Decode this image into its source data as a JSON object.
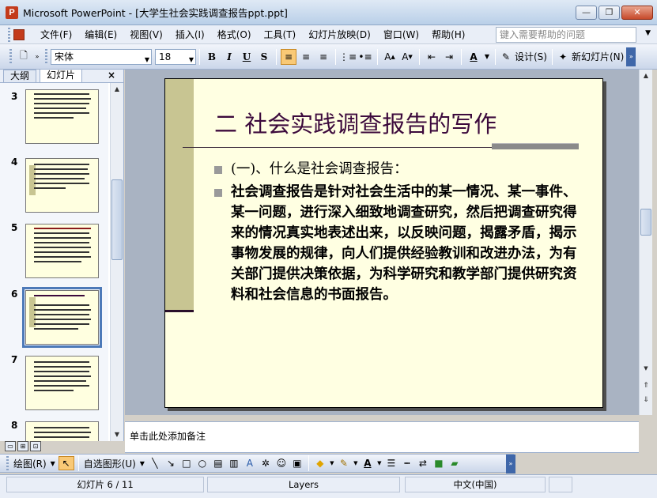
{
  "window": {
    "title": "Microsoft PowerPoint - [大学生社会实践调查报告ppt.ppt]",
    "minimize": "—",
    "restore": "❐",
    "close": "✕"
  },
  "menu": {
    "items": [
      "文件(F)",
      "编辑(E)",
      "视图(V)",
      "插入(I)",
      "格式(O)",
      "工具(T)",
      "幻灯片放映(D)",
      "窗口(W)",
      "帮助(H)"
    ],
    "help_placeholder": "键入需要帮助的问题"
  },
  "toolbar": {
    "font_name": "宋体",
    "font_size": "18",
    "bold": "B",
    "italic": "I",
    "underline": "U",
    "shadow": "S",
    "design_label": "设计(S)",
    "new_slide_label": "新幻灯片(N)"
  },
  "left_pane": {
    "tabs": [
      "大纲",
      "幻灯片"
    ],
    "close": "×",
    "thumbnails": [
      {
        "number": "3",
        "selected": false
      },
      {
        "number": "4",
        "selected": false
      },
      {
        "number": "5",
        "selected": false
      },
      {
        "number": "6",
        "selected": true
      },
      {
        "number": "7",
        "selected": false
      },
      {
        "number": "8",
        "selected": false
      }
    ]
  },
  "slide": {
    "title": "二 社会实践调查报告的写作",
    "bullets": [
      "(一)、什么是社会调查报告：",
      "社会调查报告是针对社会生活中的某一情况、某一事件、某一问题，进行深入细致地调查研究，然后把调查研究得来的情况真实地表述出来，以反映问题，揭露矛盾，揭示事物发展的规律，向人们提供经验教训和改进办法，为有关部门提供决策依据，为科学研究和教学部门提供研究资料和社会信息的书面报告。"
    ]
  },
  "notes": {
    "placeholder": "单击此处添加备注"
  },
  "drawing_toolbar": {
    "draw_label": "绘图(R)",
    "autoshape_label": "自选图形(U)"
  },
  "status": {
    "slide_indicator": "幻灯片 6 / 11",
    "design": "Layers",
    "language": "中文(中国)"
  },
  "colors": {
    "slide_background": "#ffffe2",
    "title_color": "#3c0a3c",
    "accent_bar": "#c8c592",
    "selection": "#4c79b8"
  }
}
